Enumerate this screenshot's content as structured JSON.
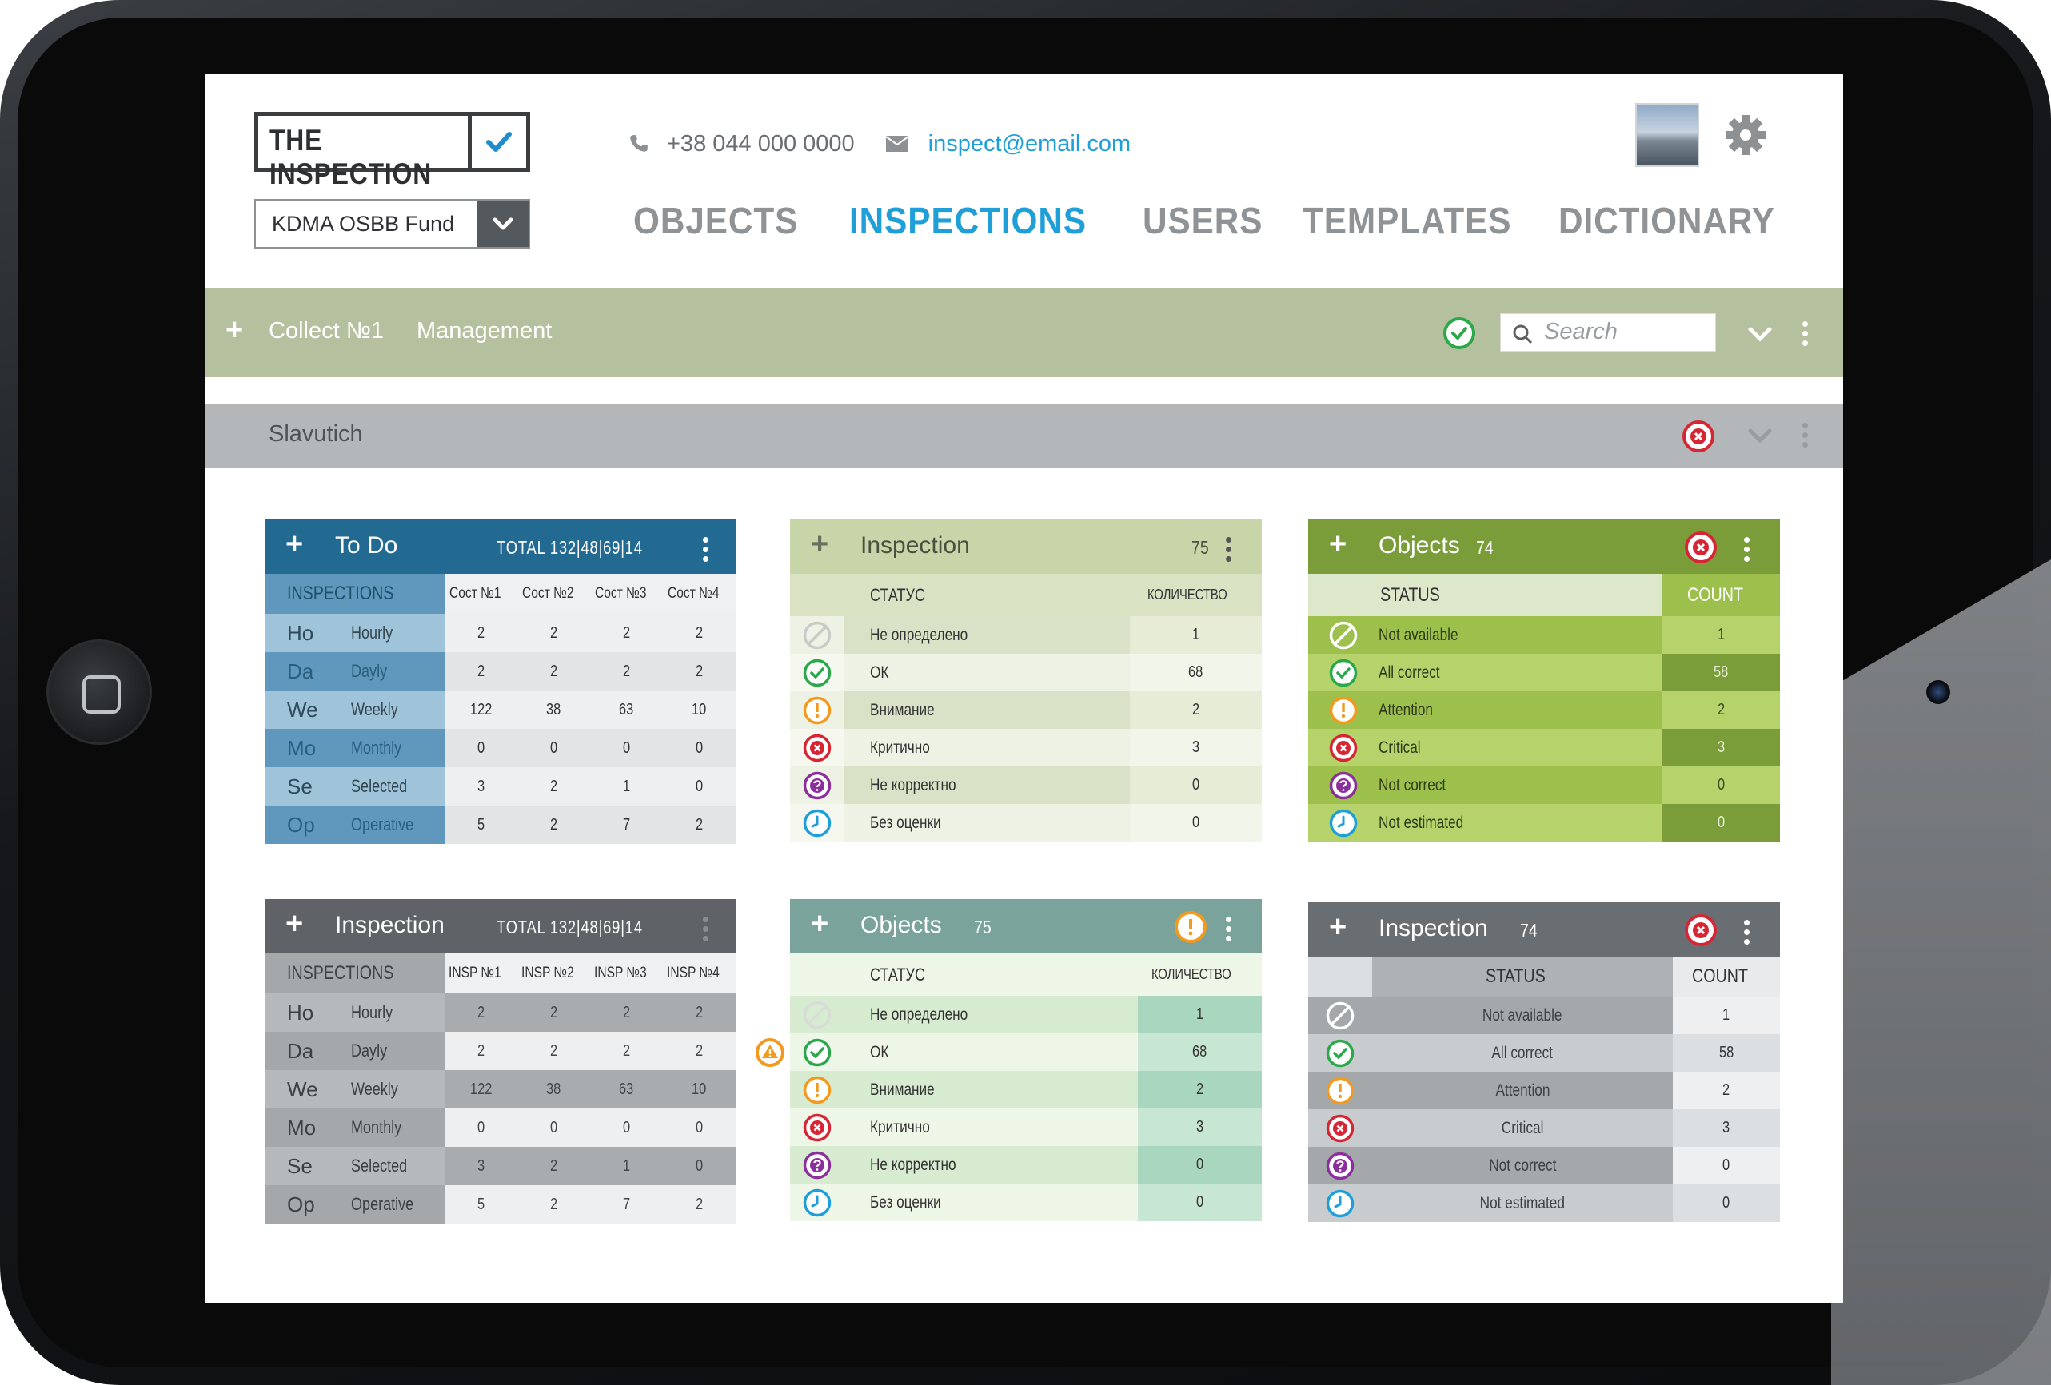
{
  "header": {
    "logo_text": "THE INSPECTION",
    "fund_select": "KDMA OSBB Fund",
    "phone": "+38 044 000 0000",
    "email": "inspect@email.com"
  },
  "nav": [
    "OBJECTS",
    "INSPECTIONS",
    "USERS",
    "TEMPLATES",
    "DICTIONARY"
  ],
  "nav_active": "INSPECTIONS",
  "bar_collect": {
    "items": [
      "Collect №1",
      "Management"
    ],
    "search_placeholder": "Search"
  },
  "bar_group": {
    "title": "Slavutich"
  },
  "colors": {
    "green_bar": "#b5c19e",
    "gray_bar": "#b4b7ba",
    "blue": "#236a93",
    "active_nav": "#1f9fd8"
  },
  "todo_panel": {
    "title": "To Do",
    "total": "TOTAL  132|48|69|14",
    "header": [
      "INSPECTIONS",
      "Сост №1",
      "Сост №2",
      "Сост №3",
      "Сост №4"
    ],
    "rows": [
      [
        "Ho",
        "Hourly",
        "2",
        "2",
        "2",
        "2"
      ],
      [
        "Da",
        "Dayly",
        "2",
        "2",
        "2",
        "2"
      ],
      [
        "We",
        "Weekly",
        "122",
        "38",
        "63",
        "10"
      ],
      [
        "Mo",
        "Monthly",
        "0",
        "0",
        "0",
        "0"
      ],
      [
        "Se",
        "Selected",
        "3",
        "2",
        "1",
        "0"
      ],
      [
        "Op",
        "Operative",
        "5",
        "2",
        "7",
        "2"
      ]
    ]
  },
  "inspection_ru_panel": {
    "title": "Inspection",
    "count": "75",
    "header": [
      "СТАТУС",
      "КОЛИЧЕСТВО"
    ],
    "rows": [
      [
        "Не определено",
        "1"
      ],
      [
        "ОК",
        "68"
      ],
      [
        "Внимание",
        "2"
      ],
      [
        "Критично",
        "3"
      ],
      [
        "Не корректно",
        "0"
      ],
      [
        "Без оценки",
        "0"
      ]
    ]
  },
  "objects_en_panel": {
    "title": "Objects",
    "count": "74",
    "header": [
      "STATUS",
      "COUNT"
    ],
    "rows": [
      [
        "Not available",
        "1"
      ],
      [
        "All correct",
        "58"
      ],
      [
        "Attention",
        "2"
      ],
      [
        "Critical",
        "3"
      ],
      [
        "Not correct",
        "0"
      ],
      [
        "Not estimated",
        "0"
      ]
    ]
  },
  "inspection_gray_panel": {
    "title": "Inspection",
    "total": "TOTAL  132|48|69|14",
    "header": [
      "INSPECTIONS",
      "INSP №1",
      "INSP №2",
      "INSP №3",
      "INSP №4"
    ],
    "rows": [
      [
        "Ho",
        "Hourly",
        "2",
        "2",
        "2",
        "2"
      ],
      [
        "Da",
        "Dayly",
        "2",
        "2",
        "2",
        "2"
      ],
      [
        "We",
        "Weekly",
        "122",
        "38",
        "63",
        "10"
      ],
      [
        "Mo",
        "Monthly",
        "0",
        "0",
        "0",
        "0"
      ],
      [
        "Se",
        "Selected",
        "3",
        "2",
        "1",
        "0"
      ],
      [
        "Op",
        "Operative",
        "5",
        "2",
        "7",
        "2"
      ]
    ]
  },
  "objects_ru_panel": {
    "title": "Objects",
    "count": "75",
    "header": [
      "СТАТУС",
      "КОЛИЧЕСТВО"
    ],
    "rows": [
      [
        "Не определено",
        "1"
      ],
      [
        "ОК",
        "68"
      ],
      [
        "Внимание",
        "2"
      ],
      [
        "Критично",
        "3"
      ],
      [
        "Не корректно",
        "0"
      ],
      [
        "Без оценки",
        "0"
      ]
    ]
  },
  "inspection_en_panel": {
    "title": "Inspection",
    "count": "74",
    "header": [
      "STATUS",
      "COUNT"
    ],
    "rows": [
      [
        "Not available",
        "1"
      ],
      [
        "All correct",
        "58"
      ],
      [
        "Attention",
        "2"
      ],
      [
        "Critical",
        "3"
      ],
      [
        "Not correct",
        "0"
      ],
      [
        "Not estimated",
        "0"
      ]
    ]
  },
  "status_icons": [
    "not-available-icon",
    "check-icon",
    "attention-icon",
    "critical-icon",
    "question-icon",
    "clock-icon"
  ]
}
